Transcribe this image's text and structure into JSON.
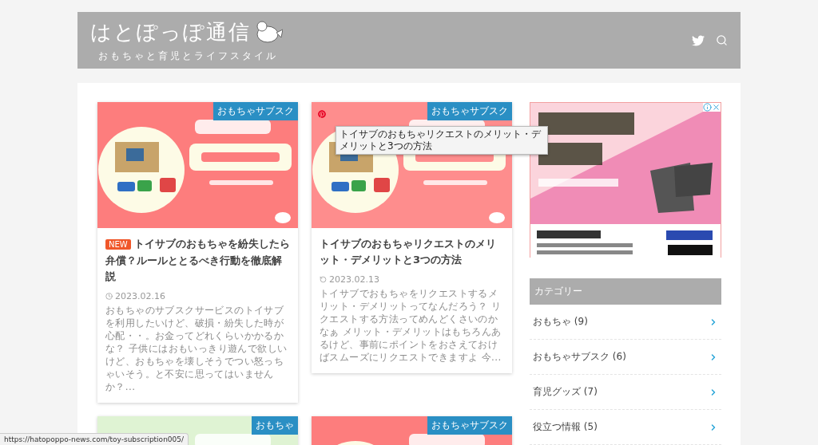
{
  "site": {
    "title": "はとぽっぽ通信",
    "tagline": "おもちゃと育児とライフスタイル"
  },
  "posts": [
    {
      "category": "おもちゃサブスク",
      "pin_button": false,
      "badge": "NEW",
      "title": "トイサブのおもちゃを紛失したら弁償？ルールととるべき行動を徹底解説",
      "updated": false,
      "date": "2023.02.16",
      "excerpt": "おもちゃのサブスクサービスのトイサブを利用したいけど、破損・紛失した時が心配・・。お金ってどれくらいかかるかな？ 子供にはおもいっきり遊んで欲しいけど、おもちゃを壊しそうでつい怒っちゃいそう。と不安に思ってはいませんか？..."
    },
    {
      "category": "おもちゃサブスク",
      "pin_button": true,
      "tooltip": "トイサブのおもちゃリクエストのメリット・デメリットと3つの方法",
      "title": "トイサブのおもちゃリクエストのメリット・デメリットと3つの方法",
      "updated": true,
      "date": "2023.02.13",
      "excerpt": "トイサブでおもちゃをリクエストするメリット・デメリットってなんだろう？ リクエストする方法ってめんどくさいのかなぁ メリット・デメリットはもちろんあるけど、事前にポイントをおさえておけばスムーズにリクエストできますよ 今..."
    },
    {
      "category": "おもちゃ",
      "pin_button": false
    },
    {
      "category": "おもちゃサブスク",
      "pin_button": false
    }
  ],
  "sidebar": {
    "categories": {
      "title": "カテゴリー",
      "items": [
        {
          "label": "おもちゃ (9)"
        },
        {
          "label": "おもちゃサブスク (6)"
        },
        {
          "label": "育児グッズ (7)"
        },
        {
          "label": "役立つ情報 (5)"
        }
      ]
    }
  },
  "status_bar": {
    "url": "https://hatopoppo-news.com/toy-subscription005/"
  }
}
